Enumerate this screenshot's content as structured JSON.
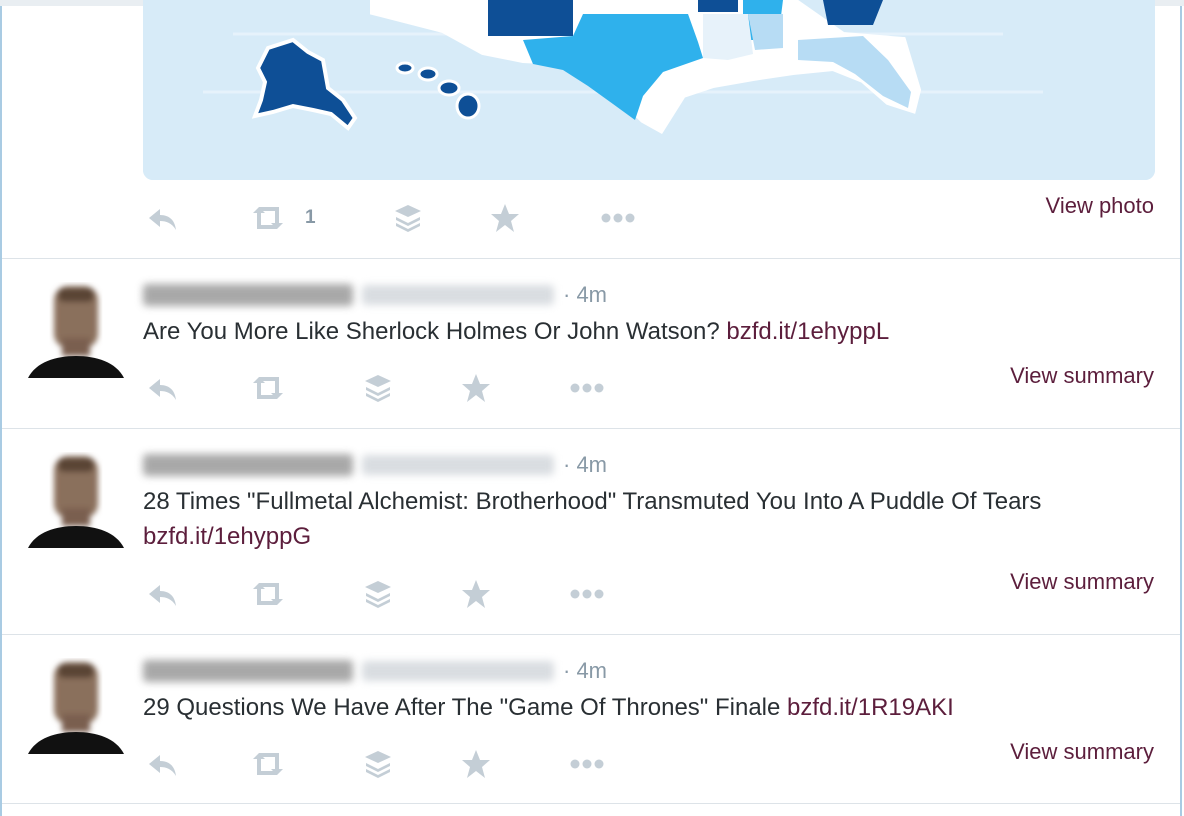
{
  "map_card": {
    "action_counts": {
      "retweet": "1"
    },
    "view_link": "View photo"
  },
  "colors": {
    "link": "#5c1e3c",
    "muted": "#8899a6",
    "text": "#292f33",
    "map_background": "#d7ebf8",
    "state_dark": "#0e4f96",
    "state_mid": "#2fb1ec",
    "state_light": "#b7dcf4"
  },
  "action_icons": [
    "reply-icon",
    "retweet-icon",
    "buffer-icon",
    "favorite-icon",
    "more-icon"
  ],
  "tweets": [
    {
      "time": "· 4m",
      "text": "Are You More Like Sherlock Holmes Or John Watson? ",
      "link": "bzfd.it/1ehyppL",
      "view_link": "View summary"
    },
    {
      "time": "· 4m",
      "text": "28 Times \"Fullmetal Alchemist: Brotherhood\" Transmuted You Into A Puddle Of Tears ",
      "link": "bzfd.it/1ehyppG",
      "view_link": "View summary"
    },
    {
      "time": "· 4m",
      "text": "29 Questions We Have After The \"Game Of Thrones\" Finale ",
      "link": "bzfd.it/1R19AKI",
      "view_link": "View summary"
    }
  ]
}
